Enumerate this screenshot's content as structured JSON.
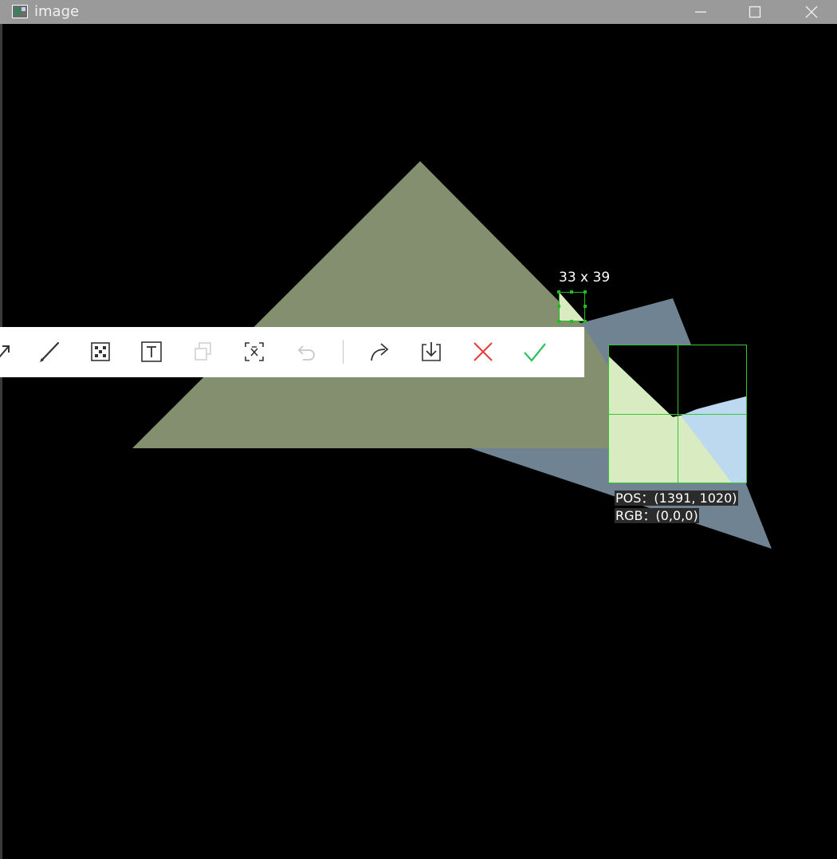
{
  "window": {
    "title": "image",
    "controls": [
      "minimize-icon",
      "maximize-icon",
      "close-icon"
    ]
  },
  "canvas": {
    "background_color": "#000000",
    "triangle_colors": {
      "olive": "#838f6f",
      "slate": "#708392"
    }
  },
  "selection": {
    "size_label": "33 x 39",
    "border_color": "#22bb22"
  },
  "toolbar": {
    "tools": [
      {
        "icon": "arrow-icon",
        "enabled": true
      },
      {
        "icon": "pen-icon",
        "enabled": true
      },
      {
        "icon": "mosaic-icon",
        "enabled": true
      },
      {
        "icon": "text-icon",
        "enabled": true
      },
      {
        "icon": "copy-icon",
        "enabled": false
      },
      {
        "icon": "ocr-icon",
        "enabled": true
      },
      {
        "icon": "undo-icon",
        "enabled": false
      },
      {
        "icon": "share-icon",
        "enabled": true
      },
      {
        "icon": "download-icon",
        "enabled": true
      },
      {
        "icon": "cancel-icon",
        "enabled": true,
        "color": "#e83a3a"
      },
      {
        "icon": "confirm-icon",
        "enabled": true,
        "color": "#2fbf5f"
      }
    ]
  },
  "magnifier": {
    "pos_text": "POS：(1391, 1020)",
    "rgb_text": "RGB：(0,0,0)",
    "colors": {
      "green_fill": "#d9ecc1",
      "blue_fill": "#bcd9ef",
      "crosshair": "#35c535"
    }
  }
}
